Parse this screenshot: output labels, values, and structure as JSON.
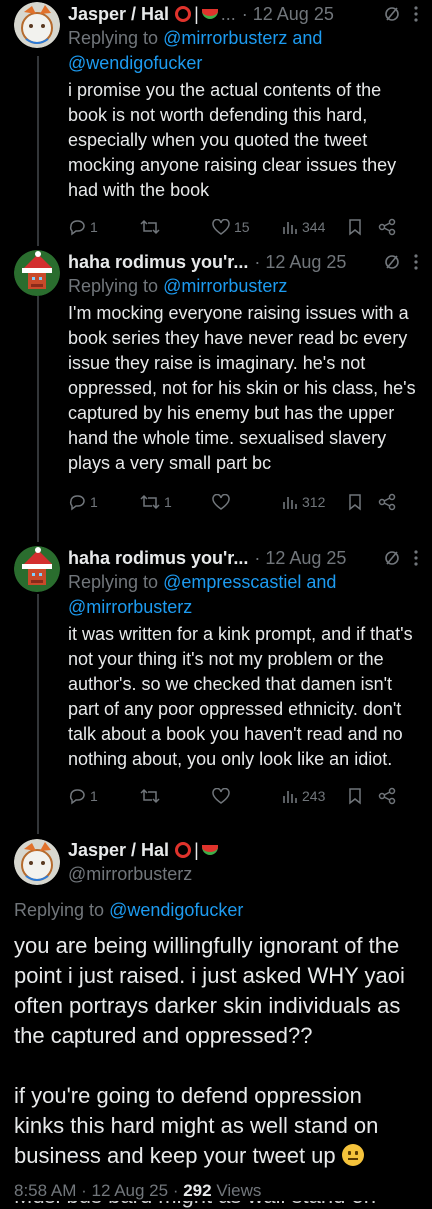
{
  "tweets": [
    {
      "display_name": "Jasper / Hal",
      "time": "· 12 Aug 25",
      "replying_prefix": "Replying to",
      "replying_mentions": "@mirrorbusterz and @wendigofucker",
      "body": "i promise you the actual contents of the book is not worth defending this hard, especially when you quoted the tweet mocking anyone raising clear issues they had with the book",
      "replies": "1",
      "retweets": "",
      "likes": "15",
      "views": "344"
    },
    {
      "display_name": "haha rodimus you'r...",
      "time": "· 12 Aug 25",
      "replying_prefix": "Replying to",
      "replying_mentions": "@mirrorbusterz",
      "body": "I'm mocking everyone raising issues with a book series they have never read bc every issue they raise is imaginary. he's not oppressed, not for his skin or his class, he's captured by his enemy but has the upper hand the whole time. sexualised slavery plays a very small part bc",
      "replies": "1",
      "retweets": "1",
      "likes": "",
      "views": "312"
    },
    {
      "display_name": "haha rodimus you'r...",
      "time": "· 12 Aug 25",
      "replying_prefix": "Replying to",
      "replying_mentions": "@empresscastiel and @mirrorbusterz",
      "body": "it was written for a kink prompt, and if that's not your thing it's not my problem or the author's. so we checked that damen isn't part of any poor oppressed ethnicity. don't talk about a book you haven't read and no nothing about, you only look like an idiot.",
      "replies": "1",
      "retweets": "",
      "likes": "",
      "views": "243"
    }
  ],
  "main": {
    "display_name": "Jasper / Hal",
    "handle": "@mirrorbusterz",
    "replying_prefix": "Replying to",
    "replying_mention": "@wendigofucker",
    "body_p1": "you are being willingfully ignorant of the point i just raised. i just asked WHY yaoi often portrays darker skin individuals as the captured and oppressed??",
    "body_p2": "if you're going to defend oppression kinks this hard might as well stand on business and keep your tweet up",
    "time": "8:58 AM",
    "date": "12 Aug 25",
    "views_count": "292",
    "views_label": "Views",
    "cutoff_text": "Musi bus bard might as wall stand on"
  },
  "colors": {
    "background": "#000000",
    "text": "#e7e9ea",
    "muted": "#71767b",
    "link": "#1d9bf0",
    "line": "#333639"
  }
}
